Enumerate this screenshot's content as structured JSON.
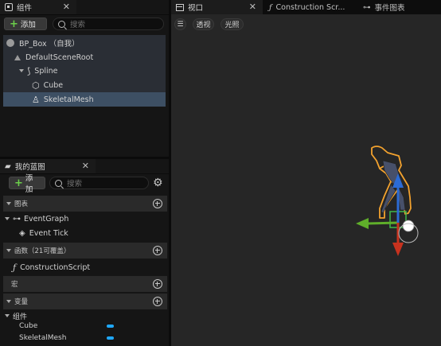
{
  "components_panel": {
    "tab_title": "组件",
    "add_label": "添加",
    "search_placeholder": "搜索",
    "tree": [
      {
        "label": "BP_Box （自我）"
      },
      {
        "label": "DefaultSceneRoot"
      },
      {
        "label": "Spline"
      },
      {
        "label": "Cube"
      },
      {
        "label": "SkeletalMesh"
      }
    ]
  },
  "my_blueprint_panel": {
    "tab_title": "我的蓝图",
    "add_label": "添加",
    "search_placeholder": "搜索",
    "sections": {
      "graphs": "图表",
      "event_graph": "EventGraph",
      "event_tick": "Event Tick",
      "functions": "函数（21可覆盖）",
      "construction_script": "ConstructionScript",
      "macros": "宏",
      "variables": "变量",
      "components_category": "组件",
      "var_cube": "Cube",
      "var_skeletal_mesh": "SkeletalMesh"
    },
    "variable_color": "#1fa8ff"
  },
  "tabs": {
    "viewport": "视口",
    "construction": "Construction Scr...",
    "event_graph": "事件图表"
  },
  "viewport": {
    "perspective_label": "透视",
    "lighting_label": "光照"
  },
  "colors": {
    "selection": "#3d4f63",
    "accent_green": "#6cd04a",
    "selection_outline": "#f3a22e"
  }
}
